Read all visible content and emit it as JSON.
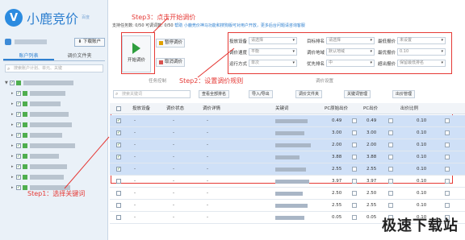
{
  "sidebar": {
    "logo_char": "V",
    "app_name": "小鹿竞价",
    "app_sub": "百度",
    "download_btn": "下载账户",
    "tabs": [
      "账户列表",
      "调价文件夹"
    ],
    "search_placeholder": "搜索账户计划、单元、关键",
    "tree_count": 11
  },
  "toolbar": {
    "stat_tasks": "支持任务数: 0/50",
    "stat_adjust": "可调词数: 0/50",
    "stat_link": "帮助",
    "stat_notice": "小鹿竞价神马功能和搜狗版可对用户开放，更多后台问题请咨询客服",
    "start_label": "开始调价",
    "pause_label": "暂停调价",
    "cancel_label": "取消调价",
    "group_task": "任务控制",
    "group_adjust": "调价设置"
  },
  "params": [
    {
      "label": "投放设备",
      "value": "请选择"
    },
    {
      "label": "目标排名",
      "value": "请选择"
    },
    {
      "label": "最低报价",
      "value": "未设置"
    },
    {
      "label": "调价速度",
      "value": "平衡"
    },
    {
      "label": "调价地域",
      "value": "默认地域"
    },
    {
      "label": "最优报价",
      "value": "0.10"
    },
    {
      "label": "运行方式",
      "value": "单次"
    },
    {
      "label": "优先排名",
      "value": "中"
    },
    {
      "label": "超出报价",
      "value": "保留最低排名"
    }
  ],
  "annotations": {
    "step3": "Step3：点击开始调价",
    "step2": "Step2：设置调价规则",
    "step1": "Step1：选择关键词"
  },
  "filter": {
    "search_placeholder": "搜索关键词",
    "btns": [
      "查看全部排名",
      "导入/导出",
      "调价文件夹",
      "关键词管理",
      "出价管理"
    ]
  },
  "table": {
    "headers": [
      "投放设备",
      "调价状态",
      "调价详情",
      "关键词",
      "PC原始出价",
      "PC出价",
      "出价比例"
    ],
    "rows": [
      {
        "device": "-",
        "status": "-",
        "detail": "-",
        "orig": "0.49",
        "price": "0.49",
        "ratio": "0.10",
        "sel": true
      },
      {
        "device": "-",
        "status": "-",
        "detail": "-",
        "orig": "3.00",
        "price": "3.00",
        "ratio": "0.10",
        "sel": true
      },
      {
        "device": "-",
        "status": "-",
        "detail": "-",
        "orig": "2.00",
        "price": "2.00",
        "ratio": "0.10",
        "sel": true
      },
      {
        "device": "-",
        "status": "-",
        "detail": "-",
        "orig": "3.88",
        "price": "3.88",
        "ratio": "0.10",
        "sel": true
      },
      {
        "device": "-",
        "status": "-",
        "detail": "-",
        "orig": "2.55",
        "price": "2.55",
        "ratio": "0.10",
        "sel": true
      },
      {
        "device": "-",
        "status": "-",
        "detail": "-",
        "orig": "3.97",
        "price": "3.97",
        "ratio": "0.10",
        "sel": false
      },
      {
        "device": "-",
        "status": "-",
        "detail": "-",
        "orig": "2.50",
        "price": "2.50",
        "ratio": "0.10",
        "sel": false
      },
      {
        "device": "-",
        "status": "-",
        "detail": "-",
        "orig": "2.55",
        "price": "2.55",
        "ratio": "0.10",
        "sel": false
      },
      {
        "device": "-",
        "status": "-",
        "detail": "-",
        "orig": "0.05",
        "price": "0.05",
        "ratio": "0.10",
        "sel": false
      }
    ]
  },
  "watermark": "极速下载站"
}
